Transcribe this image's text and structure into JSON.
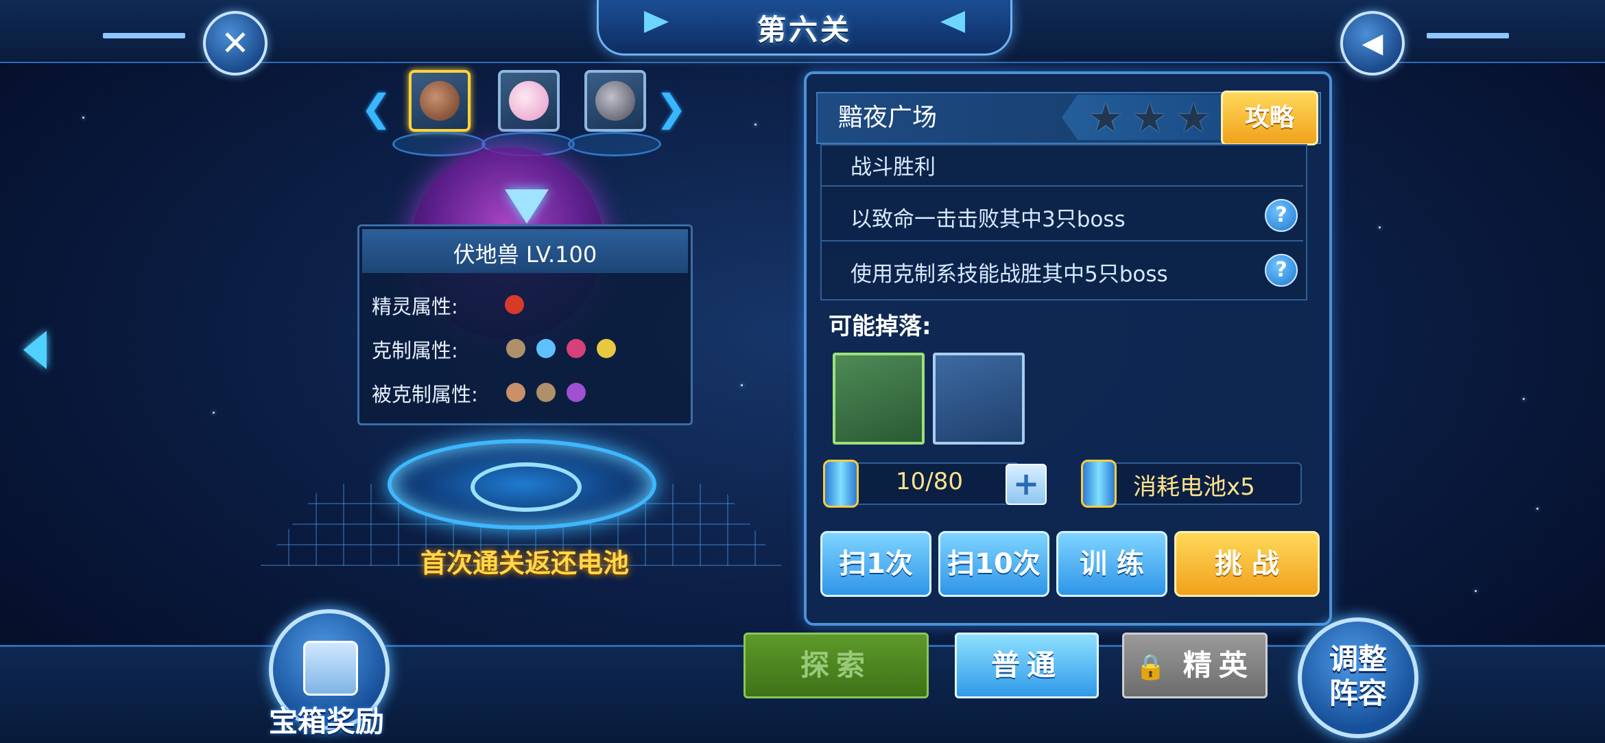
{
  "header": {
    "stage_title": "第六关",
    "close_icon": "✕",
    "back_icon": "◀"
  },
  "pet_selector": {
    "prev_icon": "❮",
    "next_icon": "❯",
    "pets": [
      {
        "name": "pet-1",
        "color": "#8a5a3a",
        "active": true
      },
      {
        "name": "pet-2",
        "color": "#f4c6e0",
        "active": false
      },
      {
        "name": "pet-3",
        "color": "#6a6a7a",
        "active": false
      }
    ]
  },
  "pet_info": {
    "name_level": "伏地兽    LV.100",
    "spirit_attr_label": "精灵属性:",
    "counter_attr_label": "克制属性:",
    "countered_attr_label": "被克制属性:",
    "spirit_icons": [
      "#d83a2a"
    ],
    "counter_icons": [
      "#b0906a",
      "#5fc0ff",
      "#d8407a",
      "#e8c840"
    ],
    "countered_icons": [
      "#c9906a",
      "#b0906a",
      "#a050d0"
    ]
  },
  "first_clear": "首次通关返还电池",
  "stage_panel": {
    "stage_name": "黯夜广场",
    "stars": 3,
    "guide_button": "攻略",
    "tasks": [
      {
        "text": "战斗胜利",
        "help": false
      },
      {
        "text": "以致命一击击败其中3只boss",
        "help": true
      },
      {
        "text": "使用克制系技能战胜其中5只boss",
        "help": true
      }
    ],
    "help_icon": "?",
    "drops_label": "可能掉落:",
    "battery_count": "10/80",
    "plus_icon": "+",
    "cost_text": "消耗电池x5"
  },
  "actions": {
    "sweep1": "扫1次",
    "sweep10": "扫10次",
    "train": "训 练",
    "challenge": "挑 战"
  },
  "bottom": {
    "treasure_label": "宝箱奖励",
    "explore": "探索",
    "normal": "普通",
    "elite": "精英",
    "lock_icon": "🔒",
    "adjust_label_1": "调整",
    "adjust_label_2": "阵容"
  }
}
